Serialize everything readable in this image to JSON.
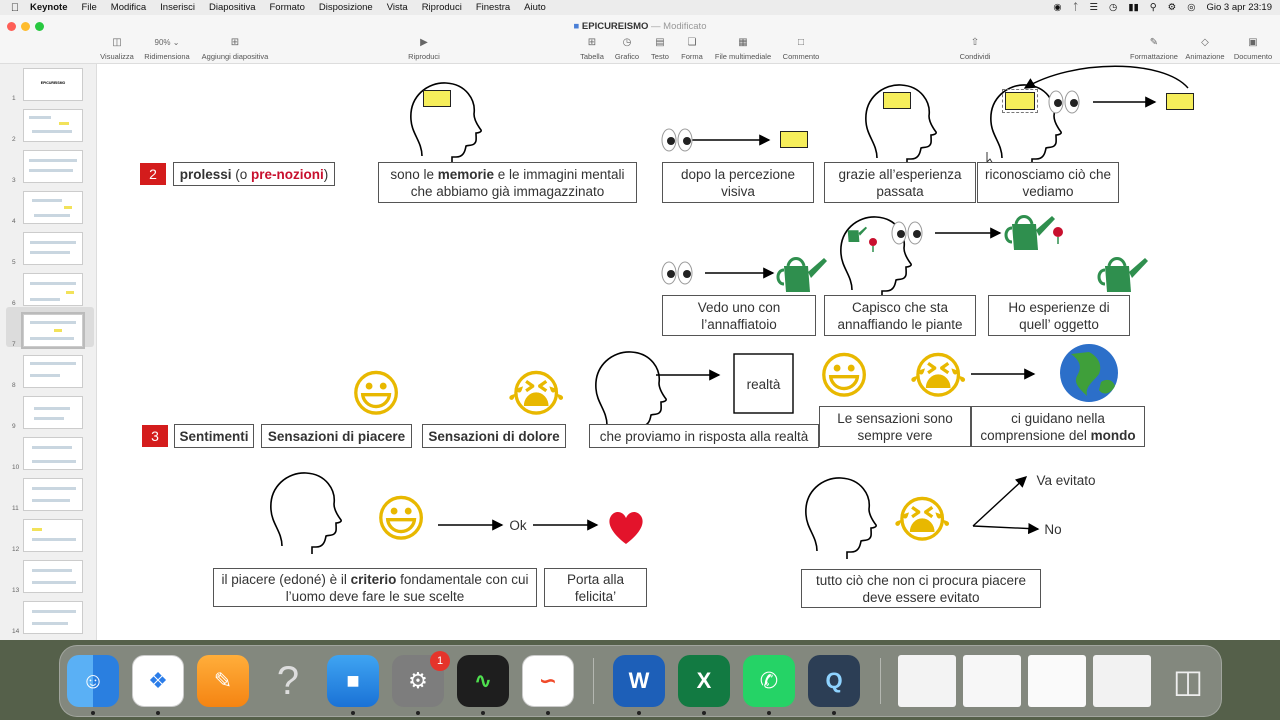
{
  "menubar": {
    "app": "Keynote",
    "items": [
      "File",
      "Modifica",
      "Inserisci",
      "Diapositiva",
      "Formato",
      "Disposizione",
      "Vista",
      "Riproduci",
      "Finestra",
      "Aiuto"
    ],
    "clock": "Gio 3 apr  23:19"
  },
  "window": {
    "title": "EPICUREISMO",
    "subtitle": "— Modificato"
  },
  "toolbar": {
    "visualizza": "Visualizza",
    "zoom": "90%",
    "ridimensiona": "Ridimensiona",
    "aggiungi": "Aggiungi diapositiva",
    "riproduci": "Riproduci",
    "tabella": "Tabella",
    "grafico": "Grafico",
    "testo": "Testo",
    "forma": "Forma",
    "media": "File multimediale",
    "commento": "Commento",
    "condividi": "Condividi",
    "formattazione": "Formattazione",
    "animazione": "Animazione",
    "documento": "Documento"
  },
  "sidebar": {
    "first_slide_title": "EPICUREISMO",
    "numbers": [
      "1",
      "2",
      "3",
      "4",
      "5",
      "6",
      "7",
      "8",
      "9",
      "10",
      "11",
      "12",
      "13",
      "14"
    ]
  },
  "slide": {
    "n2": "2",
    "prolessi_a": "prolessi",
    "prolessi_b": " (o ",
    "prolessi_c": "pre-nozioni",
    "prolessi_d": ")",
    "mem_a": "sono le ",
    "mem_b": "memorie",
    "mem_c": " e le immagini mentali che abbiamo già immagazzinato",
    "dopo": "dopo la percezione visiva",
    "grazie": "grazie all’esperienza passata",
    "riconosciamo": "riconosciamo ciò che vediamo",
    "vedo": "Vedo uno con l’annaffiatoio",
    "capisco": "Capisco che sta annaffiando le piante",
    "ho": "Ho esperienze di quell’ oggetto",
    "n3": "3",
    "sentimenti": "Sentimenti",
    "piacere": "Sensazioni di piacere",
    "dolore": "Sensazioni di dolore",
    "proviamo": "che proviamo in risposta alla realtà",
    "realta": "realtà",
    "vere": "Le sensazioni sono sempre vere",
    "guidano_a": "ci guidano nella comprensione del ",
    "guidano_b": "mondo",
    "ok": "Ok",
    "criterio_a": "il piacere (edoné) è il ",
    "criterio_b": "criterio",
    "criterio_c": " fondamentale con cui l’uomo deve fare le sue scelte",
    "felicita": "Porta alla felicita’",
    "va_evitato": "Va evitato",
    "no": "No",
    "evitato": "tutto ciò che non ci procura piacere deve essere evitato"
  },
  "dock": {
    "apps": [
      "finder-icon",
      "safari-icon",
      "pages-icon",
      "help-icon",
      "keynote-icon",
      "settings-icon",
      "activity-monitor-icon",
      "freeform-icon",
      "word-icon",
      "excel-icon",
      "whatsapp-icon",
      "quicktime-icon"
    ],
    "settings_badge": "1"
  }
}
